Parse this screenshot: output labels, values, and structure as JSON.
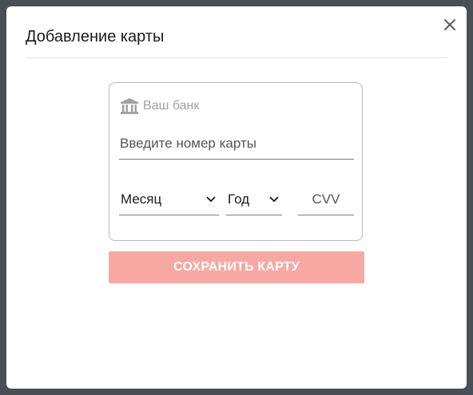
{
  "modal": {
    "title": "Добавление карты",
    "close_icon": "close-icon"
  },
  "card_form": {
    "bank_icon": "bank-icon",
    "bank_label": "Ваш банк",
    "card_number": {
      "value": "",
      "placeholder": "Введите номер карты"
    },
    "month_select": {
      "selected": "Месяц",
      "icon": "chevron-down-icon"
    },
    "year_select": {
      "selected": "Год",
      "icon": "chevron-down-icon"
    },
    "cvv": {
      "value": "",
      "placeholder": "CVV"
    }
  },
  "save_button": {
    "label": "СОХРАНИТЬ КАРТУ"
  },
  "colors": {
    "backdrop": "#4a4f56",
    "save_button_bg": "#f8a8a3",
    "placeholder_gray": "#a2a2a2"
  }
}
